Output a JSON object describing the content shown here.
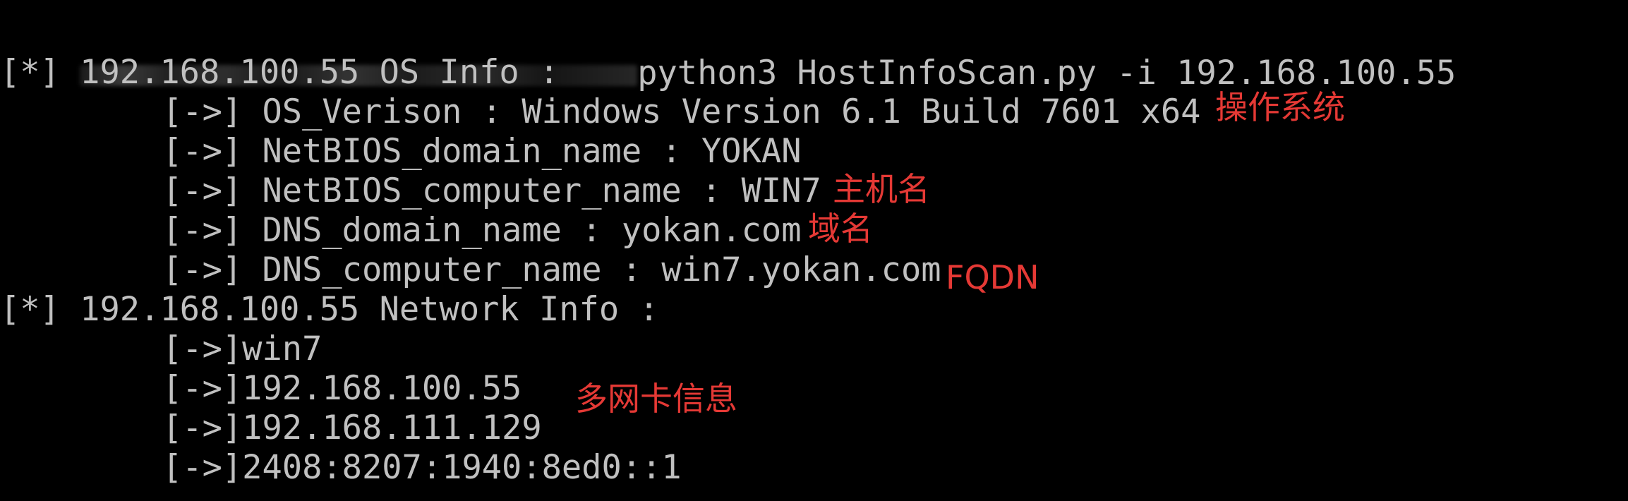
{
  "terminal": {
    "command_prompt": "python3 HostInfoScan.py -i 192.168.100.55",
    "lines": [
      "[*] 192.168.100.55 OS Info :",
      "[->] OS_Verison : Windows Version 6.1 Build 7601 x64",
      "[->] NetBIOS_domain_name : YOKAN",
      "[->] NetBIOS_computer_name : WIN7",
      "[->] DNS_domain_name : yokan.com",
      "[->] DNS_computer_name : win7.yokan.com",
      "[*] 192.168.100.55 Network Info :",
      "[->]win7",
      "[->]192.168.100.55",
      "[->]192.168.111.129",
      "[->]2408:8207:1940:8ed0::1"
    ]
  },
  "annotations": {
    "os": "操作系统",
    "hostname": "主机名",
    "domain": "域名",
    "fqdn": "FQDN",
    "multi_nic": "多网卡信息"
  },
  "colors": {
    "background": "#000000",
    "text": "#c0c0c0",
    "annotation": "#e53935"
  }
}
